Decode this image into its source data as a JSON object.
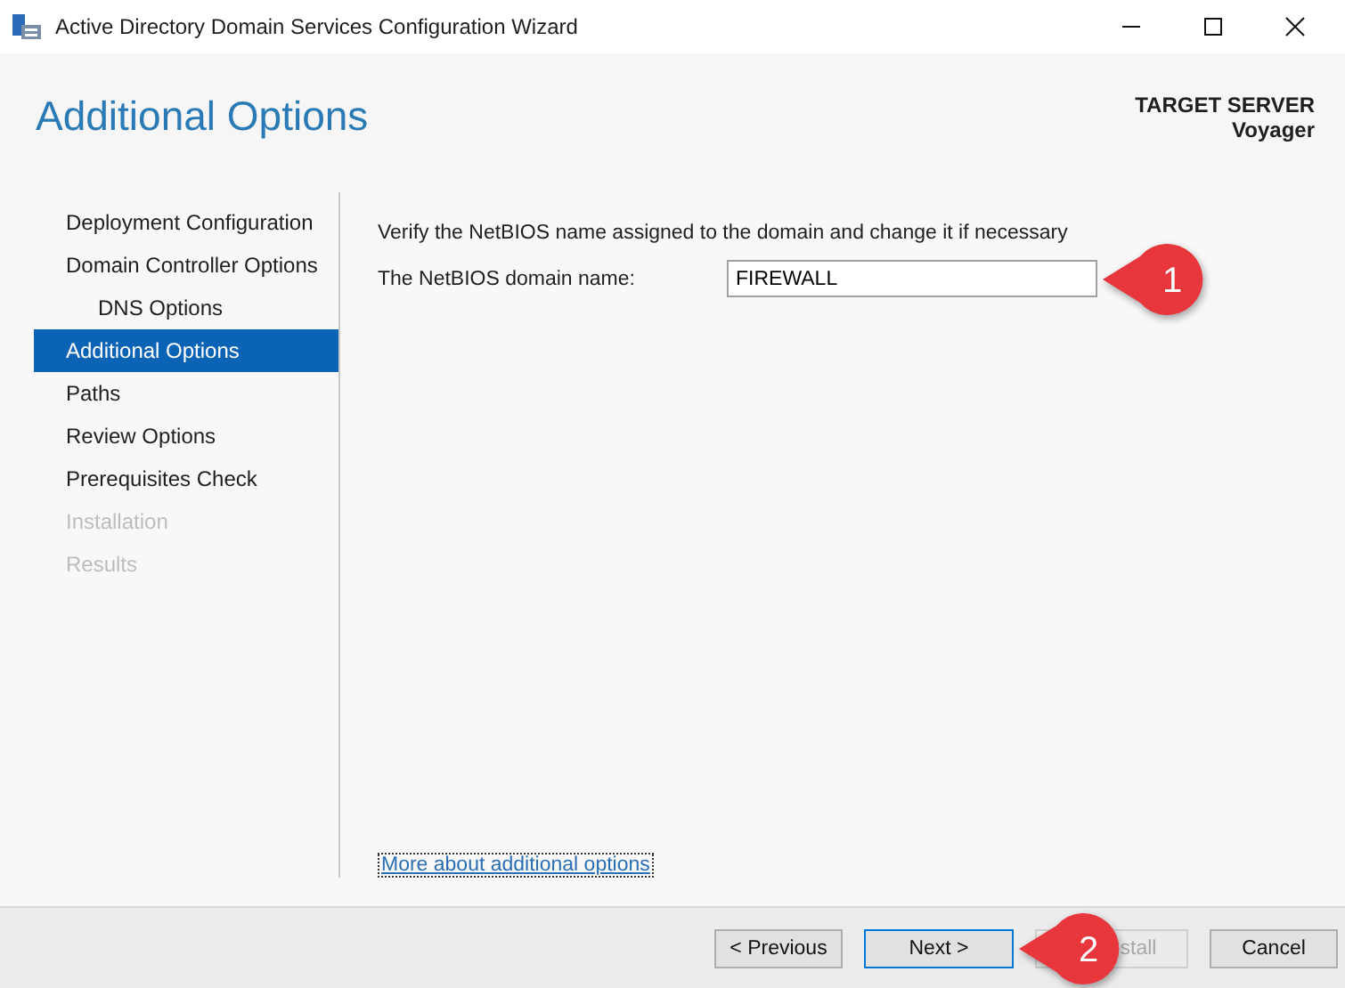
{
  "window": {
    "title": "Active Directory Domain Services Configuration Wizard"
  },
  "header": {
    "title": "Additional Options",
    "target_label": "TARGET SERVER",
    "target_name": "Voyager"
  },
  "steps": [
    {
      "label": "Deployment Configuration",
      "selected": false,
      "disabled": false
    },
    {
      "label": "Domain Controller Options",
      "selected": false,
      "disabled": false,
      "children": [
        {
          "label": "DNS Options",
          "selected": false,
          "disabled": false
        }
      ]
    },
    {
      "label": "Additional Options",
      "selected": true,
      "disabled": false
    },
    {
      "label": "Paths",
      "selected": false,
      "disabled": false
    },
    {
      "label": "Review Options",
      "selected": false,
      "disabled": false
    },
    {
      "label": "Prerequisites Check",
      "selected": false,
      "disabled": false
    },
    {
      "label": "Installation",
      "selected": false,
      "disabled": true
    },
    {
      "label": "Results",
      "selected": false,
      "disabled": true
    }
  ],
  "content": {
    "instruction": "Verify the NetBIOS name assigned to the domain and change it if necessary",
    "field_label": "The NetBIOS domain name:",
    "field_value": "FIREWALL",
    "link": "More about additional options"
  },
  "buttons": [
    {
      "label": "< Previous",
      "disabled": false,
      "default": false
    },
    {
      "label": "Next >",
      "disabled": false,
      "default": true
    },
    {
      "label": "stall",
      "disabled": true,
      "default": false
    },
    {
      "label": "Cancel",
      "disabled": false,
      "default": false
    }
  ],
  "callouts": [
    "1",
    "2"
  ]
}
